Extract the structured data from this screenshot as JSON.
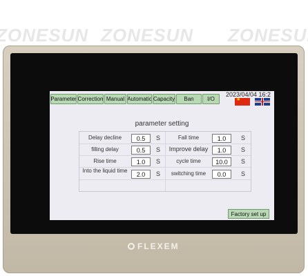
{
  "watermarks": [
    "ZONESUN",
    "ZONESUN",
    "ZONESUN"
  ],
  "tabs": [
    "Parameter",
    "Correction",
    "Manual",
    "Automatic",
    "Capacity",
    "Ban",
    "I/O"
  ],
  "datetime": "2023/04/04 16:2",
  "page_title": "parameter setting",
  "params": {
    "delay_decline": {
      "label": "Delay decline",
      "value": "0.5",
      "unit": "S"
    },
    "filling_delay": {
      "label": "filling delay",
      "value": "0.5",
      "unit": "S"
    },
    "rise_time": {
      "label": "Rise time",
      "value": "1.0",
      "unit": "S"
    },
    "into_liquid_time": {
      "label": "Into the liquid time",
      "value": "2.0",
      "unit": "S"
    },
    "fall_time": {
      "label": "Fall time",
      "value": "1.0",
      "unit": "S"
    },
    "improve_delay": {
      "label": "Improve delay",
      "value": "1.0",
      "unit": "S"
    },
    "cycle_time": {
      "label": "cycle time",
      "value": "10.0",
      "unit": "S"
    },
    "switching_time": {
      "label": "switching time",
      "value": "0.0",
      "unit": "S"
    }
  },
  "factory_button": "Factory set up",
  "brand": "FLEXEM"
}
